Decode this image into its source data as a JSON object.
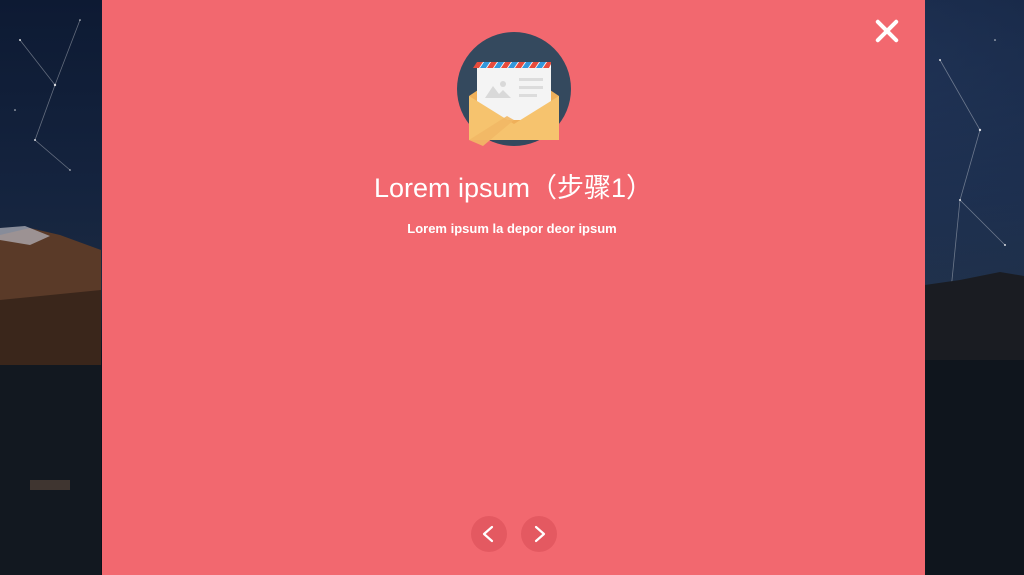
{
  "modal": {
    "title": "Lorem ipsum（步骤1）",
    "subtitle": "Lorem ipsum la depor deor ipsum",
    "icon": "envelope-letter-icon",
    "close_icon": "close-icon",
    "prev_icon": "chevron-left-icon",
    "next_icon": "chevron-right-icon"
  },
  "colors": {
    "panel_bg": "#f2686f",
    "text": "#ffffff",
    "icon_circle": "#34495e",
    "envelope": "#f6c36e",
    "envelope_dark": "#efb05a",
    "stripe_red": "#e74c3c",
    "stripe_blue": "#3498db"
  }
}
